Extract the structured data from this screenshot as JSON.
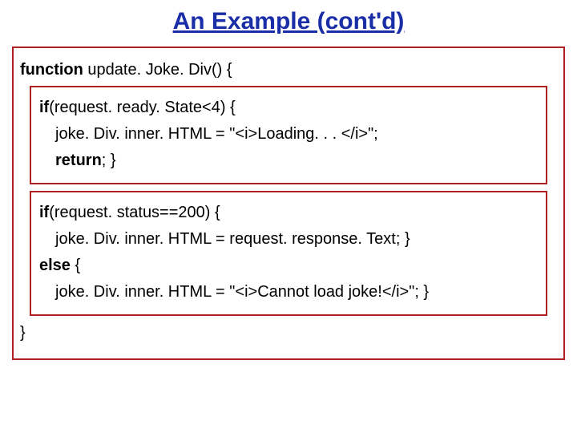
{
  "title": "An Example (cont'd)",
  "code": {
    "l1_kw": "function",
    "l1_rest": " update. Joke. Div() {",
    "box1": {
      "l2_kw": "if",
      "l2_rest": "(request. ready. State<4) {",
      "l3": "joke. Div. inner. HTML = \"<i>Loading. . . </i>\";",
      "l4_kw": "return",
      "l4_rest": "; }"
    },
    "box2": {
      "l5_kw": "if",
      "l5_rest": "(request. status==200) {",
      "l6": "joke. Div. inner. HTML = request. response. Text; }",
      "l7_kw": "else",
      "l7_rest": " {",
      "l8": "joke. Div. inner. HTML = \"<i>Cannot load joke!</i>\"; }"
    },
    "l9": "}"
  }
}
